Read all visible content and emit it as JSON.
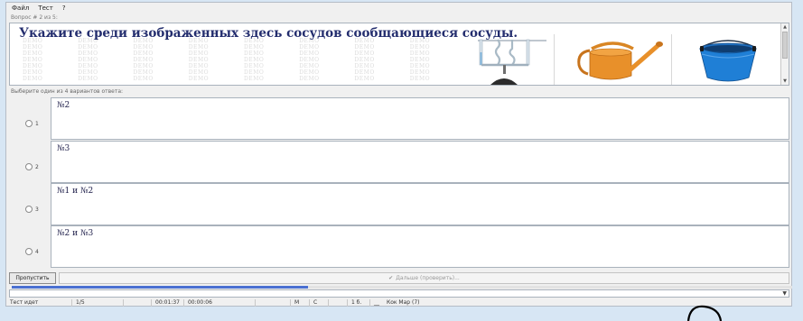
{
  "menu": {
    "items": [
      "Файл",
      "Тест",
      "?"
    ]
  },
  "question": {
    "counter": "Вопрос # 2 из 5:",
    "text": "Укажите среди изображенных здесь сосудов сообщающиеся сосуды.",
    "watermark_text": "DEMO",
    "images": [
      "communicating-vessels-image",
      "watering-can-image",
      "blue-bucket-image"
    ]
  },
  "prompt": "Выберите один из 4 вариантов ответа:",
  "answers": [
    {
      "number": "1",
      "text": "№2"
    },
    {
      "number": "2",
      "text": "№3"
    },
    {
      "number": "3",
      "text": "№1 и №2"
    },
    {
      "number": "4",
      "text": "№2 и №3"
    }
  ],
  "buttons": {
    "skip": "Пропустить",
    "next": "Дальше (проверить)..."
  },
  "progress_fraction": 0.38,
  "status": {
    "state": "Тест идет",
    "progress": "1/5",
    "elapsed": "00:01:37",
    "question_time": "00:00:06",
    "m": "M",
    "c": "C",
    "score": "1 б.",
    "user": "Кок Мар (7)"
  },
  "colors": {
    "question_text": "#232d6e",
    "progress": "#4a6fd1",
    "watering_can": "#e8902a",
    "bucket": "#1f7fd6"
  }
}
